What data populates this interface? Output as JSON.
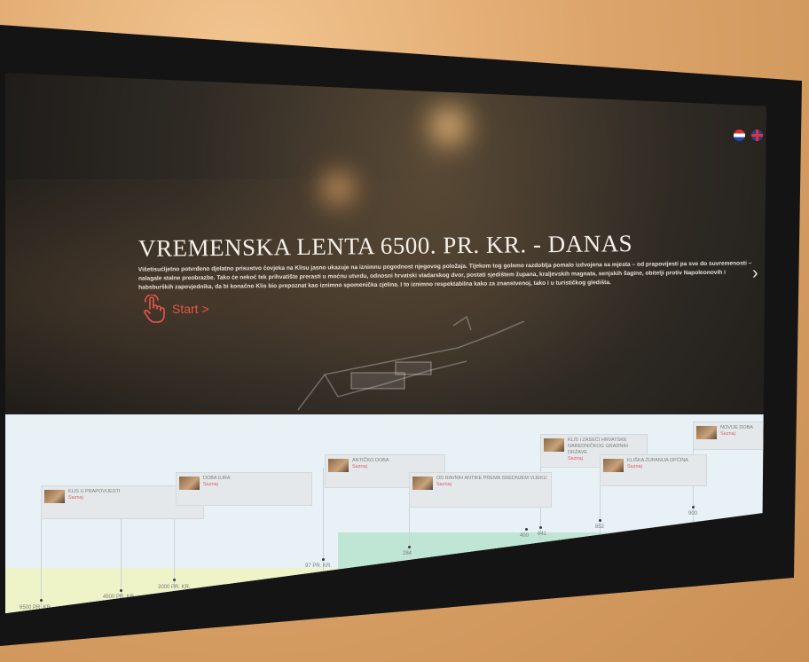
{
  "header": {
    "title": "VREMENSKA LENTA 6500. PR. KR. - DANAS",
    "intro": "Višetisućljetno potvrđeno djelatno prisustvo čovjeka na Klisu jasno ukazuje na iznimnu pogodnost njegovog položaja. Tijekom tog golemo razdoblja pomalo izdvojena sa mjesta – od prapovijesti pa sve do suvremenosti – nalagale stalne preobrazbe. Tako će nekoć tek prihvatište prerasti u moćnu utvrdu, odnosni hrvatski vladarskog dvor, postati sjedištem župana, kraljevskih magnata, senjskih šagine, obitelji protiv Napoleonovih i habsburških zapovjednika, da bi konačno Klis bio prepoznat kao iznimno spomenička cjelina. I to iznimno respektabilna kako za znanstvenoj, tako i u turističkog gledišta.",
    "start_label": "Start >",
    "next_glyph": "›"
  },
  "languages": [
    "hr-flag-icon",
    "en-flag-icon"
  ],
  "timeline": {
    "cards": [
      {
        "label": "KLIS U PRAPOVIJESTI",
        "link": "Saznaj"
      },
      {
        "label": "DOBA ILIRA",
        "link": "Saznaj"
      },
      {
        "label": "ANTIČKO DOBA",
        "link": "Saznaj"
      },
      {
        "label": "OD RAVNIH ANTIKE PREMA SREDNJEM VIJEKU",
        "link": "Saznaj"
      },
      {
        "label": "KLIS I ZASEĆI HRVATSKE NAREDNIČKOG GRADNIH DRŽAVE",
        "link": "Saznaj"
      },
      {
        "label": "KLIŠKA ŽUPANIJA OPĆINA",
        "link": "Saznaj"
      },
      {
        "label": "NOVIJE DOBA",
        "link": "Saznaj"
      }
    ],
    "ticks": [
      "6500 PR. KR.",
      "4500 PR. KR.",
      "2000 PR. KR.",
      "97 PR. KR.",
      "284",
      "400",
      "641",
      "852",
      "900"
    ]
  },
  "colors": {
    "accent": "#e8554a",
    "link": "#e05b6b",
    "band_yellow": "#eef3c8",
    "band_green": "#bfe6d4"
  }
}
